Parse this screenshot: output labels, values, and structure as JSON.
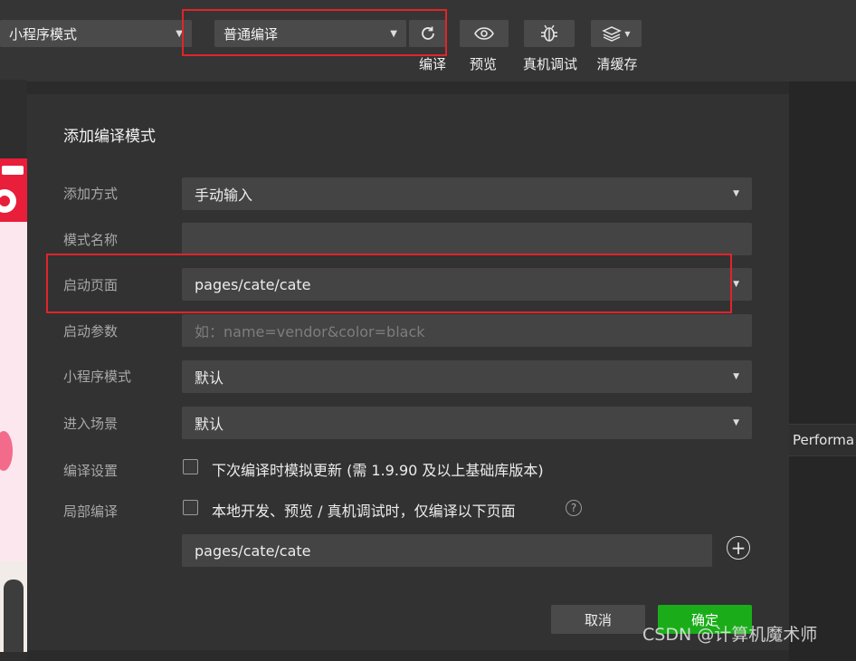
{
  "toolbar": {
    "mode_select": "小程序模式",
    "compile_select": "普通编译",
    "labels": {
      "compile": "编译",
      "preview": "预览",
      "remote_debug": "真机调试",
      "clear_cache": "清缓存"
    },
    "icons": {
      "compile": "refresh-icon",
      "preview": "eye-icon",
      "remote_debug": "bug-icon",
      "clear_cache": "layers-icon"
    }
  },
  "side_panel": {
    "tab_label": "Performa"
  },
  "dialog": {
    "title": "添加编译模式",
    "rows": {
      "add_method": {
        "label": "添加方式",
        "value": "手动输入"
      },
      "mode_name": {
        "label": "模式名称",
        "value": ""
      },
      "launch_page": {
        "label": "启动页面",
        "value": "pages/cate/cate"
      },
      "launch_params": {
        "label": "启动参数",
        "placeholder": "如：name=vendor&color=black"
      },
      "miniprogram_mode": {
        "label": "小程序模式",
        "value": "默认"
      },
      "scene": {
        "label": "进入场景",
        "value": "默认"
      },
      "compile_settings": {
        "label": "编译设置",
        "checkbox_text": "下次编译时模拟更新 (需 1.9.90 及以上基础库版本)",
        "checked": false
      },
      "partial_compile": {
        "label": "局部编译",
        "checkbox_text": "本地开发、预览 / 真机调试时，仅编译以下页面",
        "checked": false,
        "help_glyph": "?",
        "page_value": "pages/cate/cate"
      }
    },
    "buttons": {
      "cancel": "取消",
      "ok": "确定"
    }
  },
  "watermark": "CSDN @计算机魔术师",
  "colors": {
    "highlight": "#e0242a",
    "confirm": "#1aad19"
  }
}
